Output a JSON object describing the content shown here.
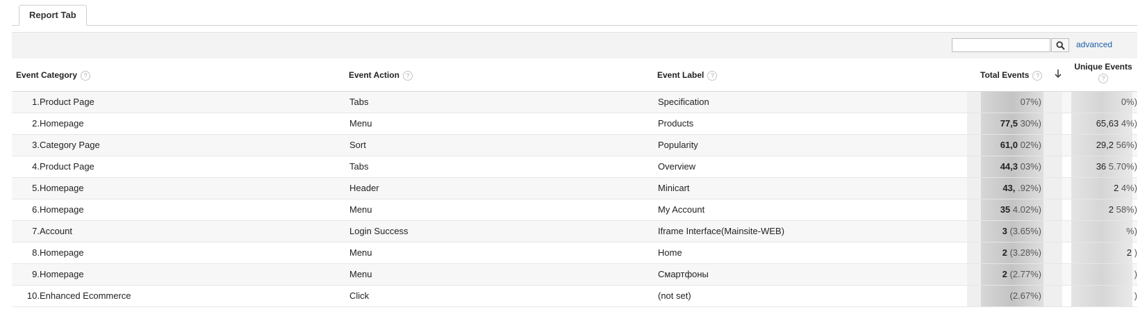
{
  "tabs": {
    "report_tab": "Report Tab"
  },
  "toolbar": {
    "search_placeholder": "",
    "search_icon": "search-icon",
    "advanced_label": "advanced"
  },
  "columns": {
    "event_category": "Event Category",
    "event_action": "Event Action",
    "event_label": "Event Label",
    "total_events": "Total Events",
    "unique_events": "Unique Events",
    "help_glyph": "?"
  },
  "sort": {
    "column": "total_events",
    "direction": "descending",
    "icon": "arrow-down-icon"
  },
  "colors": {
    "link": "#1c5ea6",
    "header_border": "#d9d9d9",
    "alt_row": "#f7f7f7"
  },
  "rows": [
    {
      "index": "1.",
      "category": "Product Page",
      "action": "Tabs",
      "label": "Specification",
      "total": "",
      "total_pct": "07%)",
      "unique": "",
      "unique_pct": "0%)"
    },
    {
      "index": "2.",
      "category": "Homepage",
      "action": "Menu",
      "label": "Products",
      "total": "77,5",
      "total_pct": "30%)",
      "unique": "65,63",
      "unique_pct": "4%)"
    },
    {
      "index": "3.",
      "category": "Category Page",
      "action": "Sort",
      "label": "Popularity",
      "total": "61,0",
      "total_pct": "02%)",
      "unique": "29,2",
      "unique_pct": "56%)"
    },
    {
      "index": "4.",
      "category": "Product Page",
      "action": "Tabs",
      "label": "Overview",
      "total": "44,3",
      "total_pct": "03%)",
      "unique": "36",
      "unique_pct": "5.70%)"
    },
    {
      "index": "5.",
      "category": "Homepage",
      "action": "Header",
      "label": "Minicart",
      "total": "43,",
      "total_pct": ".92%)",
      "unique": "2",
      "unique_pct": "4%)"
    },
    {
      "index": "6.",
      "category": "Homepage",
      "action": "Menu",
      "label": "My Account",
      "total": "35",
      "total_pct": "4.02%)",
      "unique": "2",
      "unique_pct": "58%)"
    },
    {
      "index": "7.",
      "category": "Account",
      "action": "Login Success",
      "label": "Iframe Interface(Mainsite-WEB)",
      "total": "3",
      "total_pct": "(3.65%)",
      "unique": "",
      "unique_pct": "%)"
    },
    {
      "index": "8.",
      "category": "Homepage",
      "action": "Menu",
      "label": "Home",
      "total": "2",
      "total_pct": "(3.28%)",
      "unique": "2",
      "unique_pct": ")"
    },
    {
      "index": "9.",
      "category": "Homepage",
      "action": "Menu",
      "label": "Смартфоны",
      "total": "2",
      "total_pct": "(2.77%)",
      "unique": "",
      "unique_pct": ")"
    },
    {
      "index": "10.",
      "category": "Enhanced Ecommerce",
      "action": "Click",
      "label": "(not set)",
      "total": "",
      "total_pct": "(2.67%)",
      "unique": "",
      "unique_pct": ")"
    }
  ]
}
